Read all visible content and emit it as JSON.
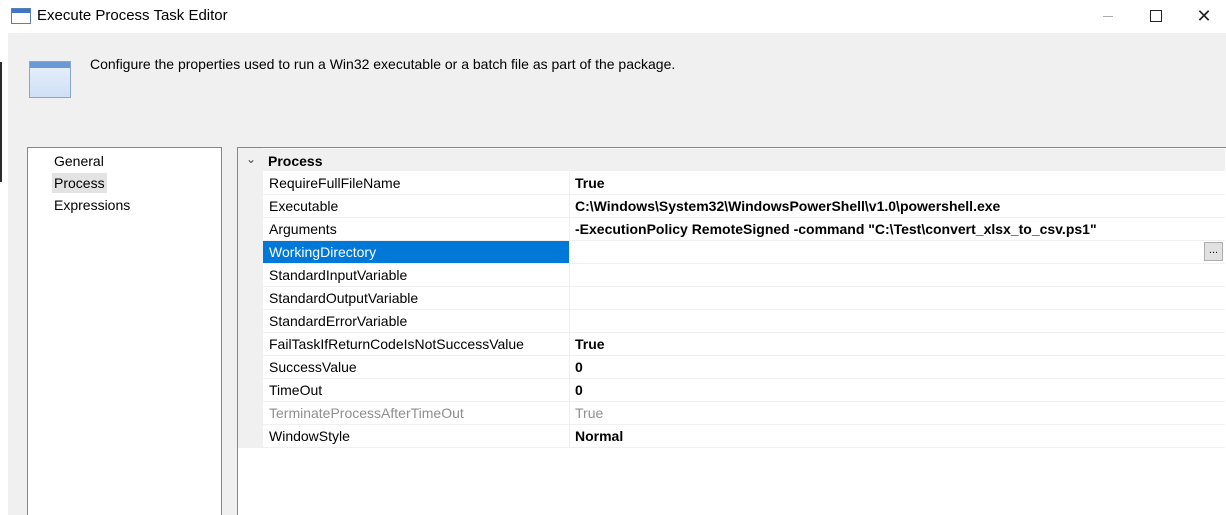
{
  "window": {
    "title": "Execute Process Task Editor",
    "icon": "window-icon",
    "controls": {
      "close_glyph": "✕"
    }
  },
  "banner": {
    "icon": "form-icon",
    "description": "Configure the properties used to run a Win32 executable or a batch file as part of the package."
  },
  "nav": {
    "items": [
      {
        "label": "General",
        "selected": false
      },
      {
        "label": "Process",
        "selected": true
      },
      {
        "label": "Expressions",
        "selected": false
      }
    ]
  },
  "grid": {
    "category": {
      "label": "Process",
      "chevron": "⌄"
    },
    "properties": [
      {
        "name": "RequireFullFileName",
        "value": "True"
      },
      {
        "name": "Executable",
        "value": "C:\\Windows\\System32\\WindowsPowerShell\\v1.0\\powershell.exe"
      },
      {
        "name": "Arguments",
        "value": "-ExecutionPolicy RemoteSigned -command \"C:\\Test\\convert_xlsx_to_csv.ps1\""
      },
      {
        "name": "WorkingDirectory",
        "value": "",
        "selected": true,
        "button": "..."
      },
      {
        "name": "StandardInputVariable",
        "value": ""
      },
      {
        "name": "StandardOutputVariable",
        "value": ""
      },
      {
        "name": "StandardErrorVariable",
        "value": ""
      },
      {
        "name": "FailTaskIfReturnCodeIsNotSuccessValue",
        "value": "True"
      },
      {
        "name": "SuccessValue",
        "value": "0"
      },
      {
        "name": "TimeOut",
        "value": "0"
      },
      {
        "name": "TerminateProcessAfterTimeOut",
        "value": "True",
        "disabled": true
      },
      {
        "name": "WindowStyle",
        "value": "Normal"
      }
    ]
  },
  "colors": {
    "selection": "#0078d7",
    "dialog_background": "#f0f0f0",
    "disabled_text": "#8f8f8f"
  }
}
